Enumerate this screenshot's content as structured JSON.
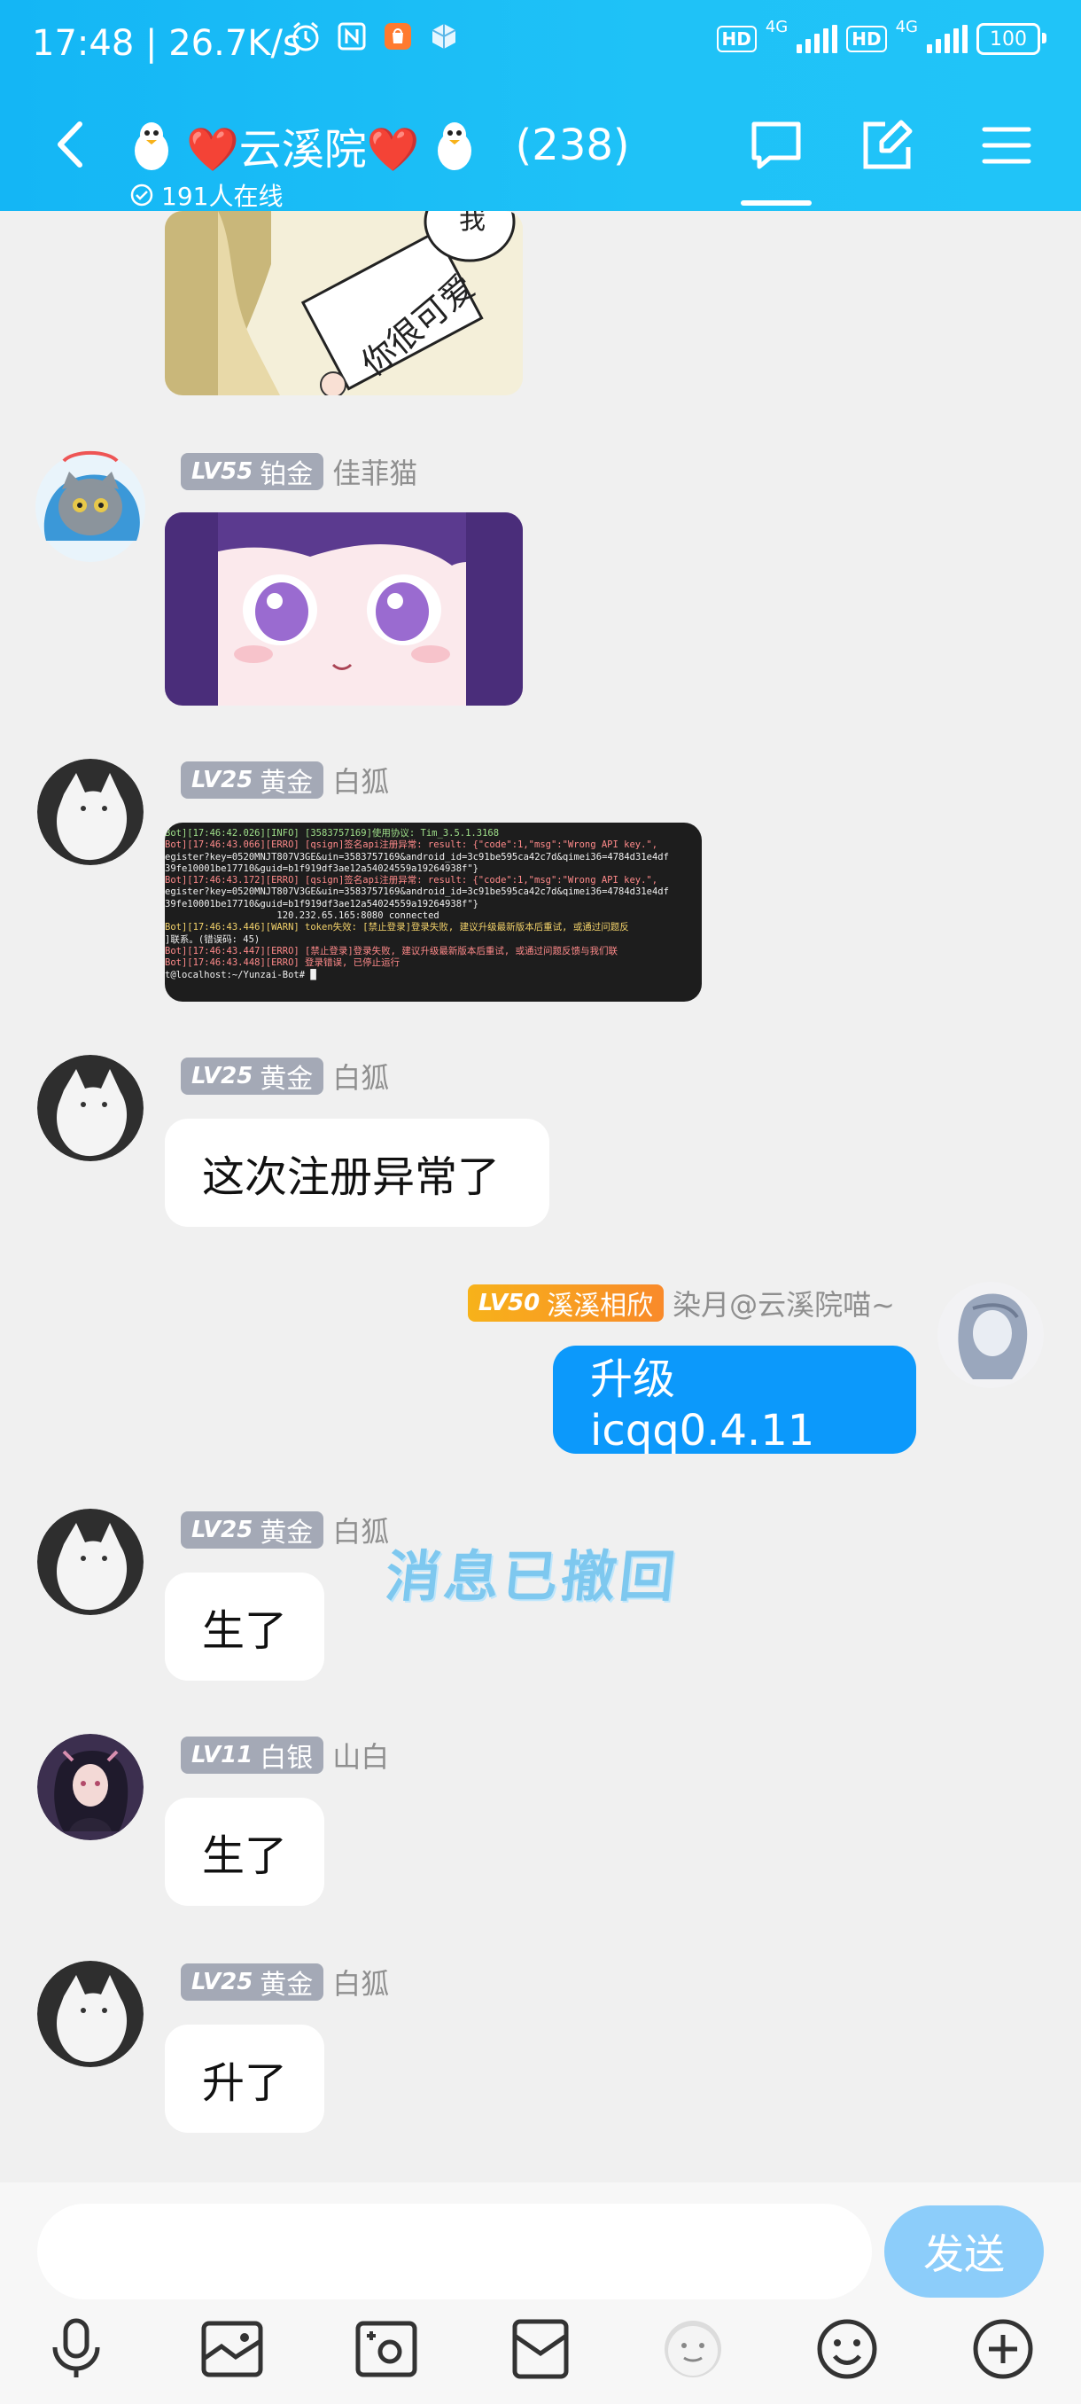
{
  "status_bar": {
    "time": "17:48",
    "speed": "26.7K/s",
    "hd1": "HD",
    "net1": "4G",
    "hd2": "HD",
    "net2": "4G",
    "battery": "100"
  },
  "header": {
    "group_name": "❤️云溪院❤️",
    "member_count": "(238)",
    "online_text": "191人在线"
  },
  "messages": {
    "m1": {
      "level": "LV55",
      "rank": "铂金",
      "nick": "佳菲猫"
    },
    "m2": {
      "level": "LV25",
      "rank": "黄金",
      "nick": "白狐"
    },
    "m3": {
      "level": "LV25",
      "rank": "黄金",
      "nick": "白狐",
      "text": "这次注册异常了"
    },
    "m4": {
      "level": "LV50",
      "rank": "溪溪相欣",
      "nick": "染月@云溪院喵~",
      "text": "升级icqq0.4.11"
    },
    "m5": {
      "level": "LV25",
      "rank": "黄金",
      "nick": "白狐",
      "text": "生了"
    },
    "m6": {
      "level": "LV11",
      "rank": "白银",
      "nick": "山白",
      "text": "生了"
    },
    "m7": {
      "level": "LV25",
      "rank": "黄金",
      "nick": "白狐",
      "text": "升了"
    }
  },
  "sticker_text": "你很可爱",
  "sticker_text2": "我",
  "recalled_text": "消息已撤回",
  "terminal_lines": [
    "Bot][17:46:42.026][INFO] [3583757169]使用协议: Tim_3.5.1.3168",
    "Bot][17:46:43.066][ERRO] [qsign]签名api注册异常: result: {\"code\":1,\"msg\":\"Wrong API key.\",",
    "egister?key=0520MNJT807V3GE&uin=3583757169&android_id=3c91be595ca42c7d&qimei36=4784d31e4df",
    "39fe10001be17710&guid=b1f919df3ae12a54024559a19264938f\"}",
    "Bot][17:46:43.172][ERRO] [qsign]签名api注册异常: result: {\"code\":1,\"msg\":\"Wrong API key.\",",
    "egister?key=0520MNJT807V3GE&uin=3583757169&android_id=3c91be595ca42c7d&qimei36=4784d31e4df",
    "39fe10001be17710&guid=b1f919df3ae12a54024559a19264938f\"}",
    "                    120.232.65.165:8080 connected",
    "Bot][17:46:43.446][WARN] token失效: [禁止登录]登录失败, 建议升级最新版本后重试, 或通过问题反",
    "]联系。(错误码: 45)",
    "Bot][17:46:43.447][ERRO] [禁止登录]登录失败, 建议升级最新版本后重试, 或通过问题反馈与我们联",
    "Bot][17:46:43.448][ERRO] 登录错误, 已停止运行",
    "t@localhost:~/Yunzai-Bot# █"
  ],
  "input": {
    "placeholder": ""
  },
  "send_label": "发送",
  "colors": {
    "header": "#1fc2f7",
    "bubble_self": "#0c99fb",
    "send": "#8ccdfa",
    "recall": "#7ec8ef"
  }
}
